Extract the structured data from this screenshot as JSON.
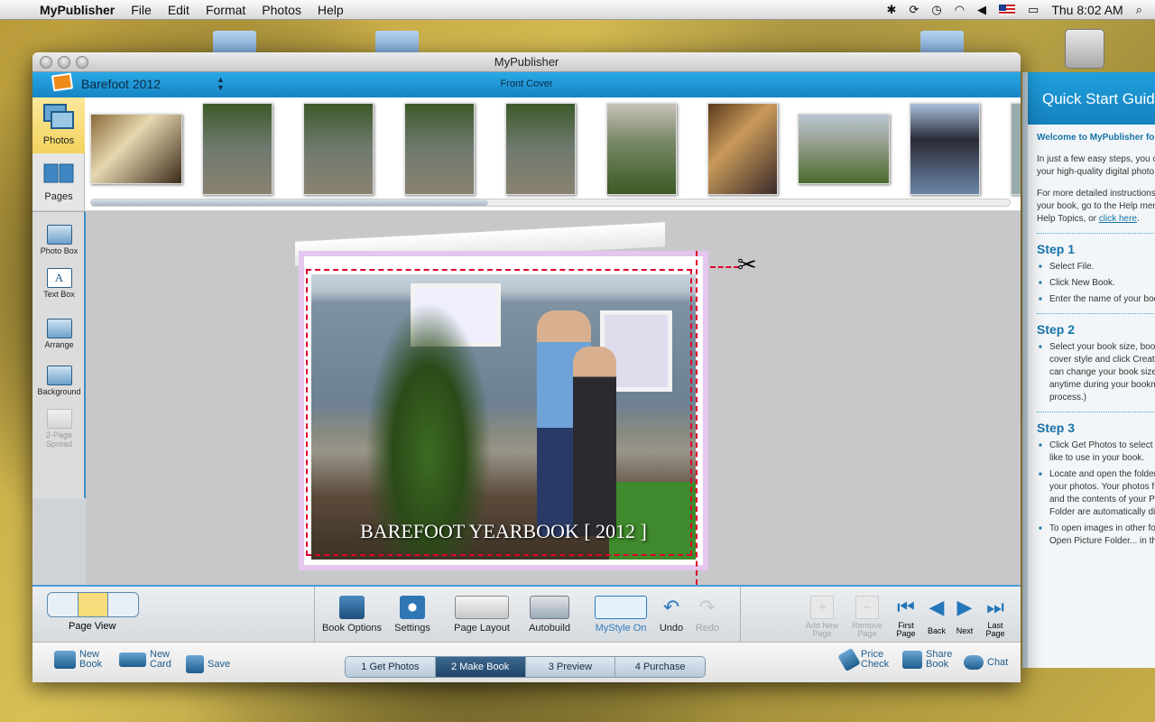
{
  "menubar": {
    "app_name": "MyPublisher",
    "menus": [
      "File",
      "Edit",
      "Format",
      "Photos",
      "Help"
    ],
    "clock": "Thu 8:02 AM"
  },
  "window": {
    "title": "MyPublisher",
    "book_title": "Barefoot 2012",
    "current_page": "Front Cover"
  },
  "sidebar": {
    "tabs": [
      {
        "label": "Photos",
        "active": true
      },
      {
        "label": "Pages",
        "active": false
      }
    ],
    "tools": [
      {
        "label": "Photo Box",
        "icon": "photo-box-icon",
        "enabled": true
      },
      {
        "label": "Text Box",
        "icon": "text-box-icon",
        "enabled": true
      },
      {
        "label": "Arrange",
        "icon": "arrange-icon",
        "enabled": true
      },
      {
        "label": "Background",
        "icon": "background-icon",
        "enabled": true
      },
      {
        "label": "2-Page Spread",
        "icon": "spread-icon",
        "enabled": false
      }
    ]
  },
  "cover": {
    "text": "BAREFOOT YEARBOOK [ 2012 ]"
  },
  "toolbar": {
    "page_view_label": "Page View",
    "book_options": "Book Options",
    "settings": "Settings",
    "page_layout": "Page Layout",
    "autobuild": "Autobuild",
    "mystyle": "MyStyle On",
    "undo": "Undo",
    "redo": "Redo",
    "add_new_page": "Add New Page",
    "remove_page": "Remove Page",
    "first_page": "First Page",
    "back": "Back",
    "next": "Next",
    "last_page": "Last Page"
  },
  "bottombar": {
    "new_book": "New Book",
    "new_card": "New Card",
    "save": "Save",
    "steps": [
      {
        "label": "1  Get Photos",
        "active": false
      },
      {
        "label": "2  Make Book",
        "active": true
      },
      {
        "label": "3  Preview",
        "active": false
      },
      {
        "label": "4  Purchase",
        "active": false
      }
    ],
    "price_check": "Price Check",
    "share_book": "Share Book",
    "chat": "Chat"
  },
  "quickstart": {
    "title": "Quick Start Guide",
    "welcome": "Welcome to MyPublisher for Mac!",
    "intro": "In just a few easy steps, you can create your high-quality digital photo book.",
    "detail": "For more detailed instructions on creating your book, go to the Help menu and select Help Topics, or",
    "link": "click here",
    "step1": "Step 1",
    "step1_items": [
      "Select File.",
      "Click New Book.",
      "Enter the name of your book."
    ],
    "step2": "Step 2",
    "step2_items": [
      "Select your book size, book style and cover style and click Create Book. (You can change your book size and style anytime during your bookmaking process.)"
    ],
    "step3": "Step 3",
    "step3_items": [
      "Click Get Photos to select photos you'd like to use in your book.",
      "Locate and open the folder containing your photos. Your photos from iPhoto and the contents of your Pictures Folder are automatically displayed.",
      "To open images in other folders, click Open Picture Folder... in the File menu."
    ]
  },
  "colors": {
    "accent_blue": "#1a8fd0",
    "trim_line": "#e0002a",
    "active_tab": "#f3d25e"
  }
}
